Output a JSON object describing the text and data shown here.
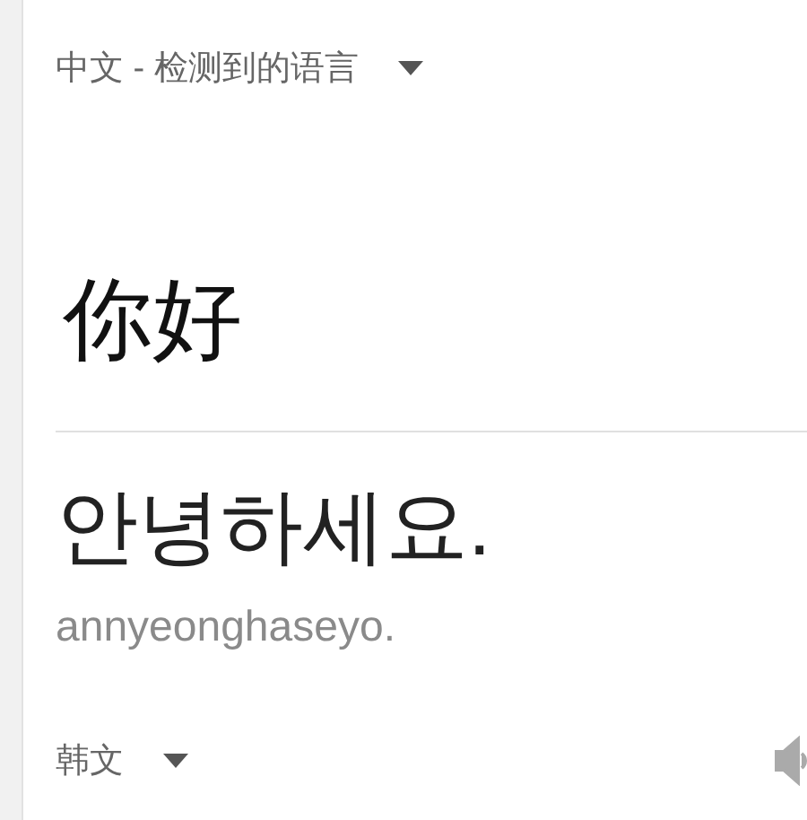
{
  "source": {
    "language": "中文 - 检测到的语言",
    "text": "你好"
  },
  "translation": {
    "text": "안녕하세요.",
    "romanization": "annyeonghaseyo.",
    "language": "韩文"
  }
}
